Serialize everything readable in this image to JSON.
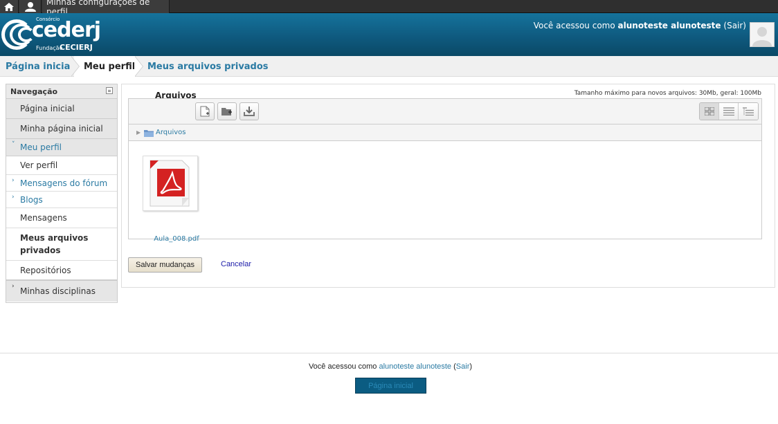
{
  "dock": {
    "home_icon": "home-icon",
    "user_icon": "user-icon",
    "profile_settings_label": "Minhas configurações de perfil"
  },
  "header": {
    "logo": {
      "consorcio": "Consórcio",
      "brand": "cederj",
      "fundacao": "Fundação",
      "cecierj": "CECIERJ"
    },
    "login_prefix": "Você acessou como",
    "username": "alunoteste alunoteste",
    "logout_label": "(Sair)"
  },
  "breadcrumb": {
    "home": "Página inicial",
    "profile": "Meu perfil",
    "private_files": "Meus arquivos privados"
  },
  "navigation": {
    "title": "Navegação",
    "items": [
      {
        "label": "Página inicial"
      },
      {
        "label": "Minha página inicial"
      },
      {
        "label": "Meu perfil"
      },
      {
        "label": "Ver perfil"
      },
      {
        "label": "Mensagens do fórum"
      },
      {
        "label": "Blogs"
      },
      {
        "label": "Mensagens"
      },
      {
        "label": "Meus arquivos privados"
      },
      {
        "label": "Repositórios"
      },
      {
        "label": "Minhas disciplinas"
      }
    ]
  },
  "files": {
    "label": "Arquivos",
    "max_size": "Tamanho máximo para novos arquivos: 30Mb, geral: 100Mb",
    "path_root": "Arquivos",
    "file_name": "Aula_008.pdf",
    "save_label": "Salvar mudanças",
    "cancel_label": "Cancelar"
  },
  "footer": {
    "login_prefix": "Você acessou como",
    "username": "alunoteste alunoteste",
    "logout_label": "Sair",
    "home_button": "Página inicial"
  },
  "colors": {
    "header_blue": "#0f5a7f",
    "link_blue": "#2a7aa3",
    "pdf_red": "#d42222"
  }
}
